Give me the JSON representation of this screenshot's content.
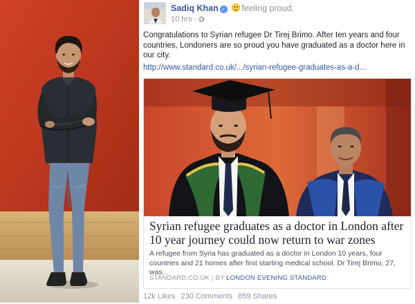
{
  "post": {
    "author": "Sadiq Khan",
    "verified_icon": "verified-badge-icon",
    "feeling_icon": "smiling-face-icon",
    "feeling": "feeling proud.",
    "time": "10 hrs",
    "separator": "·",
    "privacy_icon": "globe-icon",
    "text": "Congratulations to Syrian refugee Dr Tirej Brimo. After ten years and four countries, Londoners are so proud you have graduated as a doctor here in our city.",
    "link": "http://www.standard.co.uk/.../syrian-refugee-graduates-as-a-d..."
  },
  "card": {
    "headline": "Syrian refugee graduates as a doctor in London after 10 year journey could now return to war zones",
    "description": "A refugee from Syria has graduated as a doctor in London 10 years, four countries and 21 homes after first starting medical school. Dr Tirej Brimo, 27, was...",
    "source_domain": "STANDARD.CO.UK",
    "source_sep": " | BY ",
    "source_by": "LONDON EVENING STANDARD"
  },
  "engagement": {
    "likes": "12k Likes",
    "comments": "230 Comments",
    "shares": "859 Shares"
  },
  "colors": {
    "link_blue": "#365899",
    "meta_gray": "#90949c",
    "wall_red": "#c83a22",
    "floor_wood": "#c8a26a"
  }
}
